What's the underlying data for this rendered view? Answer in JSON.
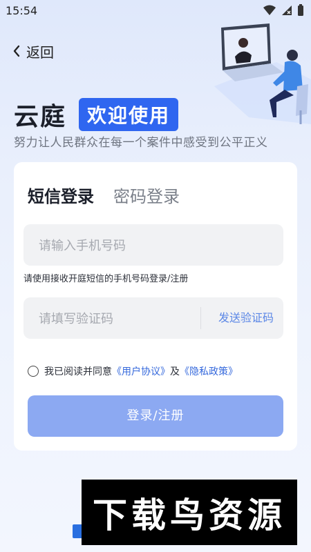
{
  "status_bar": {
    "time": "15:54"
  },
  "nav": {
    "back_label": "返回"
  },
  "brand": {
    "app_name": "云庭",
    "welcome": "欢迎使用",
    "slogan": "努力让人民群众在每一个案件中感受到公平正义"
  },
  "login": {
    "tabs": [
      {
        "label": "短信登录",
        "active": true
      },
      {
        "label": "密码登录",
        "active": false
      }
    ],
    "phone_placeholder": "请输入手机号码",
    "phone_hint": "请使用接收开庭短信的手机号码登录/注册",
    "code_placeholder": "请填写验证码",
    "send_code_label": "发送验证码",
    "agreement": {
      "prefix": "我已阅读并同意",
      "user_agreement": "《用户协议》",
      "conjunction": "及",
      "privacy_policy": "《隐私政策》",
      "checked": false
    },
    "submit_label": "登录/注册"
  },
  "watermark": {
    "text": "下载鸟资源"
  },
  "colors": {
    "accent": "#2f66f0",
    "button_disabled": "#8ca9f2",
    "link": "#3468dc"
  }
}
